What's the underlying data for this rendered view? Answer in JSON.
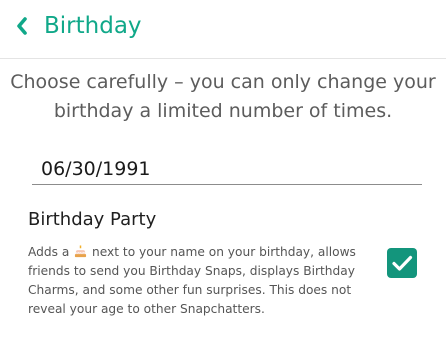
{
  "header": {
    "title": "Birthday",
    "back_icon": "chevron-left-icon"
  },
  "notice": "Choose carefully – you can only change your birthday a limited number of times.",
  "birthday_field": {
    "value": "06/30/1991"
  },
  "birthday_party": {
    "title": "Birthday Party",
    "desc_before": "Adds a",
    "desc_icon": "birthday-cake-icon",
    "desc_after": "next to your name on your birthday, allows friends to send you Birthday Snaps, displays Birthday Charms, and some other fun surprises. This does not reveal your age to other Snapchatters.",
    "enabled": true
  },
  "colors": {
    "accent": "#10a889",
    "checkbox": "#13957c",
    "text_primary": "#1f1f1f",
    "text_secondary": "#5c5c5c"
  }
}
